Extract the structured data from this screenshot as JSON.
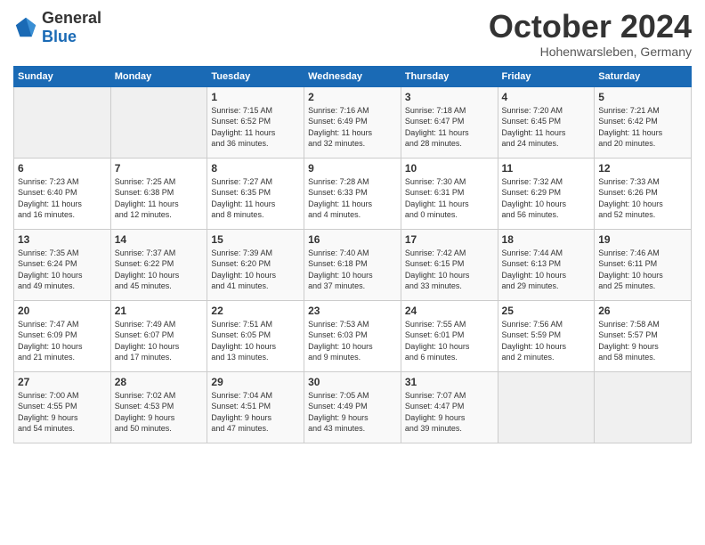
{
  "logo": {
    "general": "General",
    "blue": "Blue"
  },
  "title": "October 2024",
  "location": "Hohenwarsleben, Germany",
  "headers": [
    "Sunday",
    "Monday",
    "Tuesday",
    "Wednesday",
    "Thursday",
    "Friday",
    "Saturday"
  ],
  "weeks": [
    [
      {
        "day": "",
        "info": ""
      },
      {
        "day": "",
        "info": ""
      },
      {
        "day": "1",
        "info": "Sunrise: 7:15 AM\nSunset: 6:52 PM\nDaylight: 11 hours\nand 36 minutes."
      },
      {
        "day": "2",
        "info": "Sunrise: 7:16 AM\nSunset: 6:49 PM\nDaylight: 11 hours\nand 32 minutes."
      },
      {
        "day": "3",
        "info": "Sunrise: 7:18 AM\nSunset: 6:47 PM\nDaylight: 11 hours\nand 28 minutes."
      },
      {
        "day": "4",
        "info": "Sunrise: 7:20 AM\nSunset: 6:45 PM\nDaylight: 11 hours\nand 24 minutes."
      },
      {
        "day": "5",
        "info": "Sunrise: 7:21 AM\nSunset: 6:42 PM\nDaylight: 11 hours\nand 20 minutes."
      }
    ],
    [
      {
        "day": "6",
        "info": "Sunrise: 7:23 AM\nSunset: 6:40 PM\nDaylight: 11 hours\nand 16 minutes."
      },
      {
        "day": "7",
        "info": "Sunrise: 7:25 AM\nSunset: 6:38 PM\nDaylight: 11 hours\nand 12 minutes."
      },
      {
        "day": "8",
        "info": "Sunrise: 7:27 AM\nSunset: 6:35 PM\nDaylight: 11 hours\nand 8 minutes."
      },
      {
        "day": "9",
        "info": "Sunrise: 7:28 AM\nSunset: 6:33 PM\nDaylight: 11 hours\nand 4 minutes."
      },
      {
        "day": "10",
        "info": "Sunrise: 7:30 AM\nSunset: 6:31 PM\nDaylight: 11 hours\nand 0 minutes."
      },
      {
        "day": "11",
        "info": "Sunrise: 7:32 AM\nSunset: 6:29 PM\nDaylight: 10 hours\nand 56 minutes."
      },
      {
        "day": "12",
        "info": "Sunrise: 7:33 AM\nSunset: 6:26 PM\nDaylight: 10 hours\nand 52 minutes."
      }
    ],
    [
      {
        "day": "13",
        "info": "Sunrise: 7:35 AM\nSunset: 6:24 PM\nDaylight: 10 hours\nand 49 minutes."
      },
      {
        "day": "14",
        "info": "Sunrise: 7:37 AM\nSunset: 6:22 PM\nDaylight: 10 hours\nand 45 minutes."
      },
      {
        "day": "15",
        "info": "Sunrise: 7:39 AM\nSunset: 6:20 PM\nDaylight: 10 hours\nand 41 minutes."
      },
      {
        "day": "16",
        "info": "Sunrise: 7:40 AM\nSunset: 6:18 PM\nDaylight: 10 hours\nand 37 minutes."
      },
      {
        "day": "17",
        "info": "Sunrise: 7:42 AM\nSunset: 6:15 PM\nDaylight: 10 hours\nand 33 minutes."
      },
      {
        "day": "18",
        "info": "Sunrise: 7:44 AM\nSunset: 6:13 PM\nDaylight: 10 hours\nand 29 minutes."
      },
      {
        "day": "19",
        "info": "Sunrise: 7:46 AM\nSunset: 6:11 PM\nDaylight: 10 hours\nand 25 minutes."
      }
    ],
    [
      {
        "day": "20",
        "info": "Sunrise: 7:47 AM\nSunset: 6:09 PM\nDaylight: 10 hours\nand 21 minutes."
      },
      {
        "day": "21",
        "info": "Sunrise: 7:49 AM\nSunset: 6:07 PM\nDaylight: 10 hours\nand 17 minutes."
      },
      {
        "day": "22",
        "info": "Sunrise: 7:51 AM\nSunset: 6:05 PM\nDaylight: 10 hours\nand 13 minutes."
      },
      {
        "day": "23",
        "info": "Sunrise: 7:53 AM\nSunset: 6:03 PM\nDaylight: 10 hours\nand 9 minutes."
      },
      {
        "day": "24",
        "info": "Sunrise: 7:55 AM\nSunset: 6:01 PM\nDaylight: 10 hours\nand 6 minutes."
      },
      {
        "day": "25",
        "info": "Sunrise: 7:56 AM\nSunset: 5:59 PM\nDaylight: 10 hours\nand 2 minutes."
      },
      {
        "day": "26",
        "info": "Sunrise: 7:58 AM\nSunset: 5:57 PM\nDaylight: 9 hours\nand 58 minutes."
      }
    ],
    [
      {
        "day": "27",
        "info": "Sunrise: 7:00 AM\nSunset: 4:55 PM\nDaylight: 9 hours\nand 54 minutes."
      },
      {
        "day": "28",
        "info": "Sunrise: 7:02 AM\nSunset: 4:53 PM\nDaylight: 9 hours\nand 50 minutes."
      },
      {
        "day": "29",
        "info": "Sunrise: 7:04 AM\nSunset: 4:51 PM\nDaylight: 9 hours\nand 47 minutes."
      },
      {
        "day": "30",
        "info": "Sunrise: 7:05 AM\nSunset: 4:49 PM\nDaylight: 9 hours\nand 43 minutes."
      },
      {
        "day": "31",
        "info": "Sunrise: 7:07 AM\nSunset: 4:47 PM\nDaylight: 9 hours\nand 39 minutes."
      },
      {
        "day": "",
        "info": ""
      },
      {
        "day": "",
        "info": ""
      }
    ]
  ]
}
